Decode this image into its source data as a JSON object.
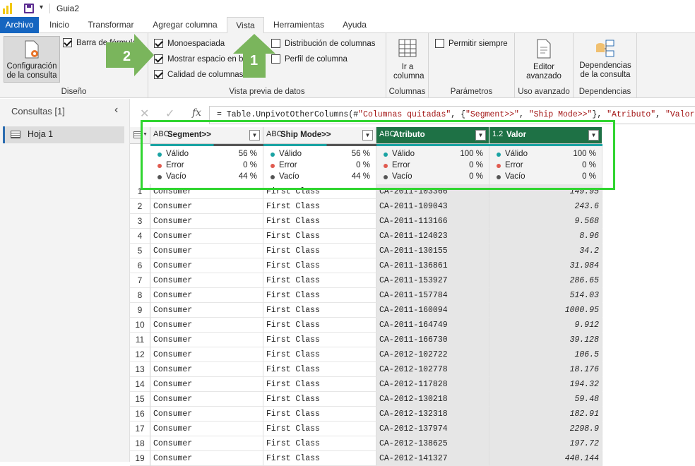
{
  "titlebar": {
    "title": "Guia2"
  },
  "tabs": [
    {
      "label": "Archivo"
    },
    {
      "label": "Inicio"
    },
    {
      "label": "Transformar"
    },
    {
      "label": "Agregar columna"
    },
    {
      "label": "Vista"
    },
    {
      "label": "Herramientas"
    },
    {
      "label": "Ayuda"
    }
  ],
  "ribbon": {
    "diseno": {
      "config_btn": "Configuración de la consulta",
      "barra_formulas": "Barra de fórmulas",
      "label": "Diseño"
    },
    "vista_previa": {
      "monoespaciada": "Monoespaciada",
      "mostrar_espacio": "Mostrar espacio en blanco",
      "calidad": "Calidad de columnas",
      "distribucion": "Distribución de columnas",
      "perfil": "Perfil de columna",
      "label": "Vista previa de datos"
    },
    "columnas": {
      "ir_columna": "Ir a columna",
      "label": "Columnas"
    },
    "parametros": {
      "permitir": "Permitir siempre",
      "label": "Parámetros"
    },
    "uso_avanzado": {
      "editor": "Editor avanzado",
      "label": "Uso avanzado"
    },
    "dependencias": {
      "btn": "Dependencias de la consulta",
      "label": "Dependencias"
    }
  },
  "queries": {
    "header": "Consultas [1]",
    "items": [
      {
        "label": "Hoja 1"
      }
    ]
  },
  "formula": {
    "prefix": "= Table.UnpivotOtherColumns(#",
    "s1": "\"Columnas quitadas\"",
    "m1": ", {",
    "s2": "\"Segment>>\"",
    "m2": ", ",
    "s3": "\"Ship Mode>>\"",
    "m3": "}, ",
    "s4": "\"Atributo\"",
    "m4": ", ",
    "s5": "\"Valor\"",
    "m5": ")"
  },
  "columns": [
    {
      "name": "Segment>>",
      "type": "ABC",
      "valid": "56 %",
      "error": "0 %",
      "empty": "44 %",
      "valid_frac": 0.56
    },
    {
      "name": "Ship Mode>>",
      "type": "ABC",
      "valid": "56 %",
      "error": "0 %",
      "empty": "44 %",
      "valid_frac": 0.56
    },
    {
      "name": "Atributo",
      "type": "ABC",
      "valid": "100 %",
      "error": "0 %",
      "empty": "0 %",
      "valid_frac": 1.0
    },
    {
      "name": "Valor",
      "type": "1.2",
      "valid": "100 %",
      "error": "0 %",
      "empty": "0 %",
      "valid_frac": 1.0
    }
  ],
  "quality_labels": {
    "valid": "Válido",
    "error": "Error",
    "empty": "Vacío"
  },
  "colors": {
    "valid": "#1aa3a3",
    "error": "#e05a4f",
    "empty": "#555555",
    "selected_header": "#1e7145",
    "highlight": "#30d530",
    "arrow": "#7ab55c"
  },
  "callouts": {
    "one": "1",
    "two": "2"
  },
  "rows": [
    {
      "n": "1",
      "a": "Consumer",
      "b": "First Class",
      "c": "CA-2011-103366",
      "d": "149.95"
    },
    {
      "n": "2",
      "a": "Consumer",
      "b": "First Class",
      "c": "CA-2011-109043",
      "d": "243.6"
    },
    {
      "n": "3",
      "a": "Consumer",
      "b": "First Class",
      "c": "CA-2011-113166",
      "d": "9.568"
    },
    {
      "n": "4",
      "a": "Consumer",
      "b": "First Class",
      "c": "CA-2011-124023",
      "d": "8.96"
    },
    {
      "n": "5",
      "a": "Consumer",
      "b": "First Class",
      "c": "CA-2011-130155",
      "d": "34.2"
    },
    {
      "n": "6",
      "a": "Consumer",
      "b": "First Class",
      "c": "CA-2011-136861",
      "d": "31.984"
    },
    {
      "n": "7",
      "a": "Consumer",
      "b": "First Class",
      "c": "CA-2011-153927",
      "d": "286.65"
    },
    {
      "n": "8",
      "a": "Consumer",
      "b": "First Class",
      "c": "CA-2011-157784",
      "d": "514.03"
    },
    {
      "n": "9",
      "a": "Consumer",
      "b": "First Class",
      "c": "CA-2011-160094",
      "d": "1000.95"
    },
    {
      "n": "10",
      "a": "Consumer",
      "b": "First Class",
      "c": "CA-2011-164749",
      "d": "9.912"
    },
    {
      "n": "11",
      "a": "Consumer",
      "b": "First Class",
      "c": "CA-2011-166730",
      "d": "39.128"
    },
    {
      "n": "12",
      "a": "Consumer",
      "b": "First Class",
      "c": "CA-2012-102722",
      "d": "106.5"
    },
    {
      "n": "13",
      "a": "Consumer",
      "b": "First Class",
      "c": "CA-2012-102778",
      "d": "18.176"
    },
    {
      "n": "14",
      "a": "Consumer",
      "b": "First Class",
      "c": "CA-2012-117828",
      "d": "194.32"
    },
    {
      "n": "15",
      "a": "Consumer",
      "b": "First Class",
      "c": "CA-2012-130218",
      "d": "59.48"
    },
    {
      "n": "16",
      "a": "Consumer",
      "b": "First Class",
      "c": "CA-2012-132318",
      "d": "182.91"
    },
    {
      "n": "17",
      "a": "Consumer",
      "b": "First Class",
      "c": "CA-2012-137974",
      "d": "2298.9"
    },
    {
      "n": "18",
      "a": "Consumer",
      "b": "First Class",
      "c": "CA-2012-138625",
      "d": "197.72"
    },
    {
      "n": "19",
      "a": "Consumer",
      "b": "First Class",
      "c": "CA-2012-141327",
      "d": "440.144"
    }
  ]
}
